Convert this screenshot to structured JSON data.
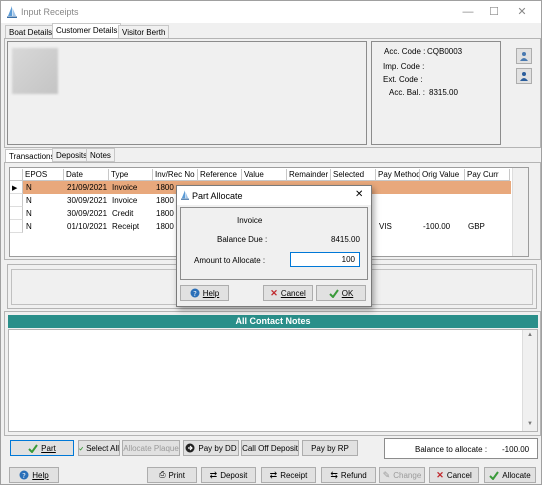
{
  "window": {
    "title": "Input Receipts"
  },
  "top_tabs": [
    "Boat Details",
    "Customer Details",
    "Visitor Berth"
  ],
  "account": {
    "acc_code_label": "Acc. Code :",
    "acc_code_value": "CQB0003",
    "imp_code_label": "Imp. Code :",
    "imp_code_value": "",
    "ext_code_label": "Ext. Code :",
    "ext_code_value": "",
    "acc_bal_label": "Acc. Bal. :",
    "acc_bal_value": "8315.00"
  },
  "lower_tabs": [
    "Transactions",
    "Deposits",
    "Notes"
  ],
  "grid": {
    "headers": [
      "EPOS",
      "Date",
      "Type",
      "Inv/Rec No",
      "Reference",
      "Value",
      "Remainder",
      "Selected",
      "Pay Method",
      "Orig Value",
      "Pay Curr"
    ],
    "rows": [
      {
        "epos": "N",
        "date": "21/09/2021",
        "type": "Invoice",
        "inv": "1800",
        "pay_method": "",
        "orig_value": "",
        "pay_curr": ""
      },
      {
        "epos": "N",
        "date": "30/09/2021",
        "type": "Invoice",
        "inv": "1800",
        "pay_method": "",
        "orig_value": "",
        "pay_curr": ""
      },
      {
        "epos": "N",
        "date": "30/09/2021",
        "type": "Credit",
        "inv": "1800",
        "pay_method": "",
        "orig_value": "",
        "pay_curr": ""
      },
      {
        "epos": "N",
        "date": "01/10/2021",
        "type": "Receipt",
        "inv": "1800",
        "pay_method": "VIS",
        "orig_value": "-100.00",
        "pay_curr": "GBP"
      }
    ]
  },
  "notes_header": "All Contact Notes",
  "action_buttons": {
    "part": "Part",
    "select_all": "Select All",
    "allocate_plaque": "Allocate Plaque",
    "pay_by_dd": "Pay by DD",
    "call_off_deposit": "Call Off Deposit",
    "pay_by_rp": "Pay by RP"
  },
  "balance": {
    "label": "Balance to allocate :",
    "value": "-100.00"
  },
  "bottom_buttons": {
    "help": "Help",
    "print": "Print",
    "deposit": "Deposit",
    "receipt": "Receipt",
    "refund": "Refund",
    "change": "Change",
    "cancel": "Cancel",
    "allocate": "Allocate"
  },
  "dialog": {
    "title": "Part Allocate",
    "type_text": "Invoice",
    "balance_due_label": "Balance Due :",
    "balance_due_value": "8415.00",
    "amount_label": "Amount to Allocate :",
    "amount_value": "100",
    "help": "Help",
    "cancel": "Cancel",
    "ok": "OK"
  },
  "colors": {
    "selected_row": "#e8a87c",
    "teal": "#2a8f8a",
    "focus": "#0078d7"
  }
}
